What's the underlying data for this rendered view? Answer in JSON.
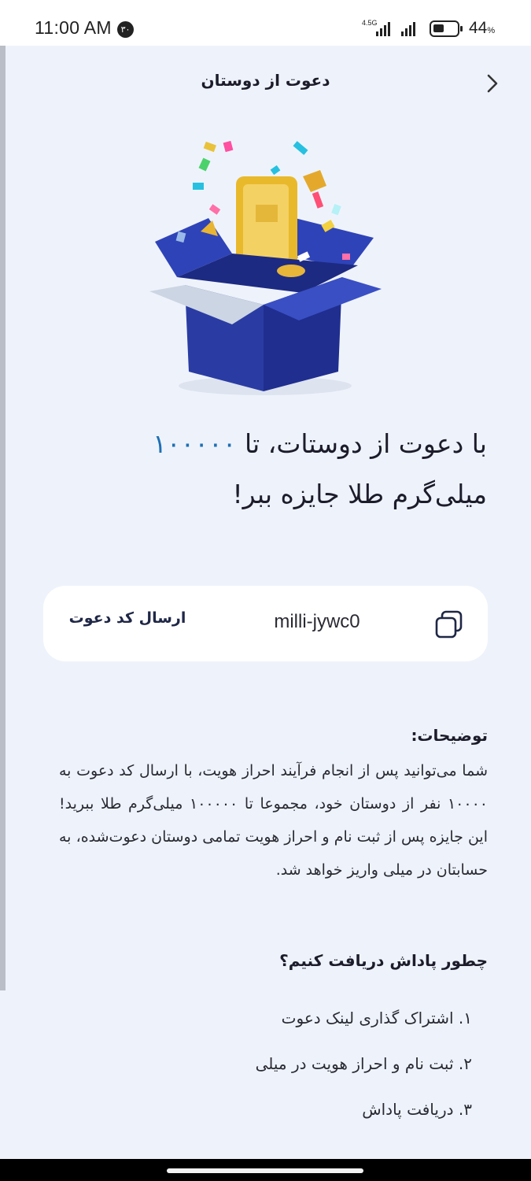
{
  "status_bar": {
    "time": "11:00 AM",
    "notification_badge": "۳۰",
    "network": "4.5G",
    "battery_percent": "44",
    "battery_unit": "%",
    "battery_level": 0.44
  },
  "header": {
    "title": "دعوت از دوستان"
  },
  "headline": {
    "line1_prefix": "با دعوت از دوستات، تا ",
    "amount": "۱۰۰۰۰۰",
    "line2": "میلی‌گرم طلا جایزه ببر!"
  },
  "invite": {
    "code": "milli-jywc0",
    "send_label": "ارسال کد دعوت"
  },
  "description": {
    "title": "توضیحات:",
    "body": "شما می‌توانید پس از انجام فرآیند احراز هویت، با ارسال کد دعوت به ۱۰۰۰۰ نفر از دوستان خود، مجموعا تا ۱۰۰۰۰۰ میلی‌گرم طلا ببرید! این جایزه پس از ثبت نام و احراز هویت تمامی دوستان دعوت‌شده، به حسابتان در میلی واریز خواهد شد."
  },
  "howto": {
    "title": "چطور پاداش دریافت کنیم؟",
    "steps": [
      "۱. اشتراک گذاری لینک دعوت",
      "۲. ثبت نام و احراز هویت در میلی",
      "۳. دریافت پاداش"
    ]
  },
  "colors": {
    "accent": "#1d6fb5",
    "page_background": "#eef3fb",
    "card_background": "#ffffff",
    "box_blue": "#27389b",
    "gold": "#e9b92c"
  },
  "icons": {
    "back": "chevron-right-icon",
    "copy": "copy-icon",
    "hero": "gift-box-gold-illustration"
  }
}
